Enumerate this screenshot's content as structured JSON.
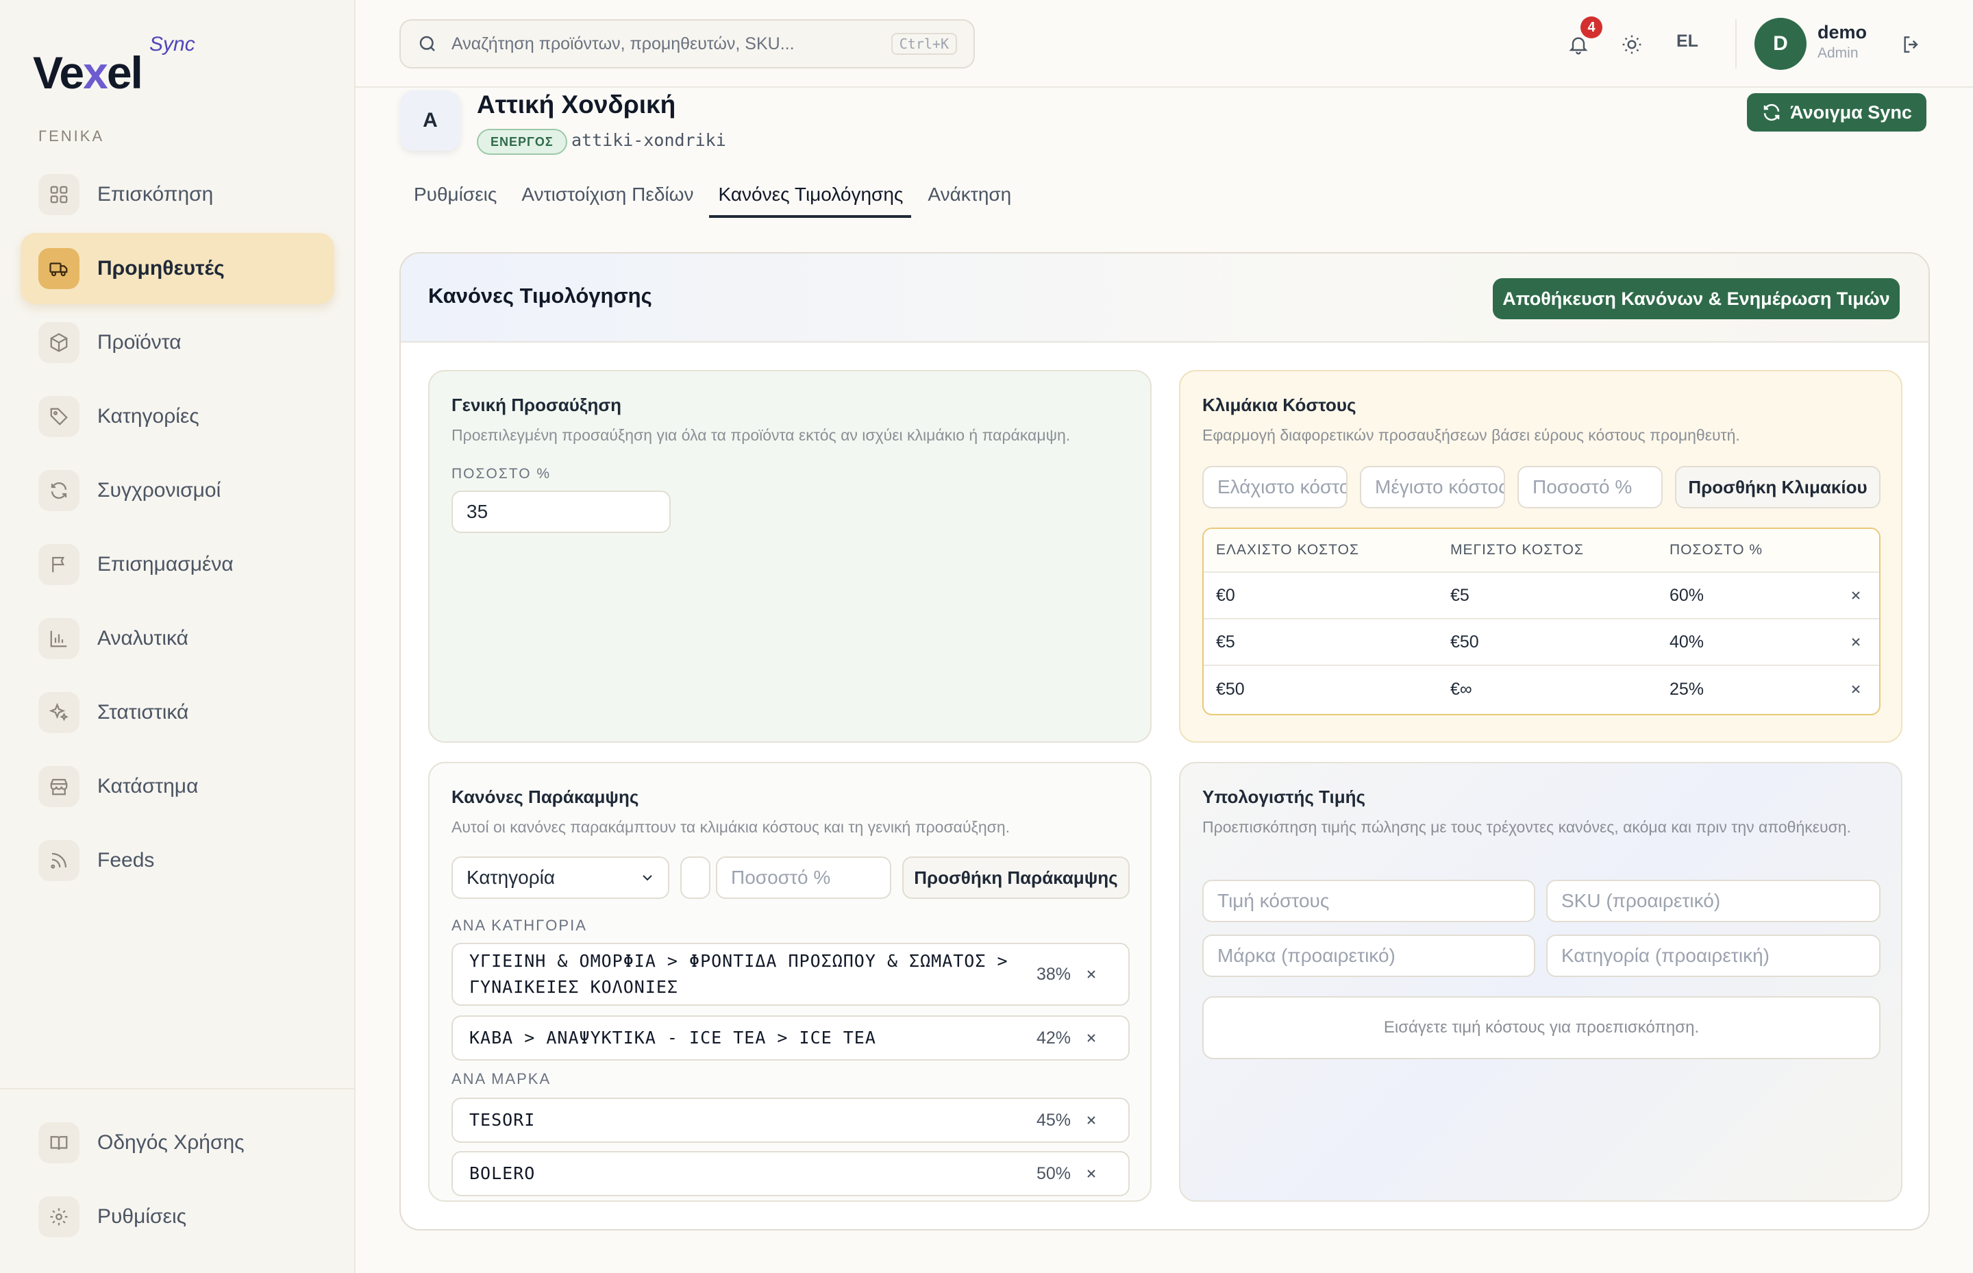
{
  "app": {
    "logo_main": "Vexel",
    "logo_sync": "Sync"
  },
  "sidebar": {
    "section_label": "ΓΕΝΙΚΑ",
    "items": [
      {
        "label": "Επισκόπηση",
        "icon": "grid-icon"
      },
      {
        "label": "Προμηθευτές",
        "icon": "truck-icon",
        "active": true
      },
      {
        "label": "Προϊόντα",
        "icon": "box-icon"
      },
      {
        "label": "Κατηγορίες",
        "icon": "tag-icon"
      },
      {
        "label": "Συγχρονισμοί",
        "icon": "refresh-icon"
      },
      {
        "label": "Επισημασμένα",
        "icon": "flag-icon"
      },
      {
        "label": "Αναλυτικά",
        "icon": "bar-chart-icon"
      },
      {
        "label": "Στατιστικά",
        "icon": "sparkles-icon"
      },
      {
        "label": "Κατάστημα",
        "icon": "store-icon"
      },
      {
        "label": "Feeds",
        "icon": "rss-icon"
      }
    ],
    "bottom": [
      {
        "label": "Οδηγός Χρήσης",
        "icon": "book-icon"
      },
      {
        "label": "Ρυθμίσεις",
        "icon": "gear-icon"
      }
    ]
  },
  "topbar": {
    "search_placeholder": "Αναζήτηση προϊόντων, προμηθευτών, SKU...",
    "shortcut": "Ctrl+K",
    "notifications_count": "4",
    "language": "EL",
    "user_initial": "D",
    "user_name": "demo",
    "user_role": "Admin"
  },
  "supplier": {
    "initial": "A",
    "name": "Αττική Χονδρική",
    "status": "ΕΝΕΡΓΟΣ",
    "slug": "attiki-xondriki",
    "open_sync_label": "Άνοιγμα Sync"
  },
  "tabs": [
    {
      "label": "Ρυθμίσεις"
    },
    {
      "label": "Αντιστοίχιση Πεδίων"
    },
    {
      "label": "Κανόνες Τιμολόγησης",
      "active": true
    },
    {
      "label": "Ανάκτηση"
    }
  ],
  "pricing": {
    "title": "Κανόνες Τιμολόγησης",
    "save_label": "Αποθήκευση Κανόνων & Ενημέρωση Τιμών",
    "general": {
      "title": "Γενική Προσαύξηση",
      "description": "Προεπιλεγμένη προσαύξηση για όλα τα προϊόντα εκτός αν ισχύει κλιμάκιο ή παράκαμψη.",
      "field_label": "ΠΟΣΟΣΤΟ %",
      "value": "35"
    },
    "tiers": {
      "title": "Κλιμάκια Κόστους",
      "description": "Εφαρμογή διαφορετικών προσαυξήσεων βάσει εύρους κόστους προμηθευτή.",
      "min_placeholder": "Ελάχιστο κόστος",
      "max_placeholder": "Μέγιστο κόστος",
      "pct_placeholder": "Ποσοστό %",
      "add_label": "Προσθήκη Κλιμακίου",
      "headers": [
        "ΕΛΑΧΙΣΤΟ ΚΟΣΤΟΣ",
        "ΜΕΓΙΣΤΟ ΚΟΣΤΟΣ",
        "ΠΟΣΟΣΤΟ %"
      ],
      "rows": [
        {
          "min": "€0",
          "max": "€5",
          "pct": "60%"
        },
        {
          "min": "€5",
          "max": "€50",
          "pct": "40%"
        },
        {
          "min": "€50",
          "max": "€∞",
          "pct": "25%"
        }
      ]
    },
    "overrides": {
      "title": "Κανόνες Παράκαμψης",
      "description": "Αυτοί οι κανόνες παρακάμπτουν τα κλιμάκια κόστους και τη γενική προσαύξηση.",
      "type_selected": "Κατηγορία",
      "pct_placeholder": "Ποσοστό %",
      "add_label": "Προσθήκη Παράκαμψης",
      "category_label": "ΑΝΑ ΚΑΤΗΓΟΡΙΑ",
      "categories": [
        {
          "name": "ΥΓΙΕΙΝΗ & ΟΜΟΡΦΙΑ > ΦΡΟΝΤΙΔΑ ΠΡΟΣΩΠΟΥ & ΣΩΜΑΤΟΣ > ΓΥΝΑΙΚΕΙΕΣ ΚΟΛΟΝΙΕΣ",
          "pct": "38%"
        },
        {
          "name": "ΚΑΒΑ > ΑΝΑΨΥΚΤΙΚΑ - ICE TEA > ICE TEA",
          "pct": "42%"
        }
      ],
      "brand_label": "ΑΝΑ ΜΑΡΚΑ",
      "brands": [
        {
          "name": "TESORI",
          "pct": "45%"
        },
        {
          "name": "BOLERO",
          "pct": "50%"
        }
      ]
    },
    "calculator": {
      "title": "Υπολογιστής Τιμής",
      "description": "Προεπισκόπηση τιμής πώλησης με τους τρέχοντες κανόνες, ακόμα και πριν την αποθήκευση.",
      "cost_placeholder": "Τιμή κόστους",
      "sku_placeholder": "SKU (προαιρετικό)",
      "brand_placeholder": "Μάρκα (προαιρετικό)",
      "category_placeholder": "Κατηγορία (προαιρετική)",
      "preview_text": "Εισάγετε τιμή κόστους για προεπισκόπηση."
    }
  },
  "colors": {
    "accent": "#2f6b4a",
    "active_nav": "#f6e5bf",
    "danger": "#d32f2f"
  }
}
